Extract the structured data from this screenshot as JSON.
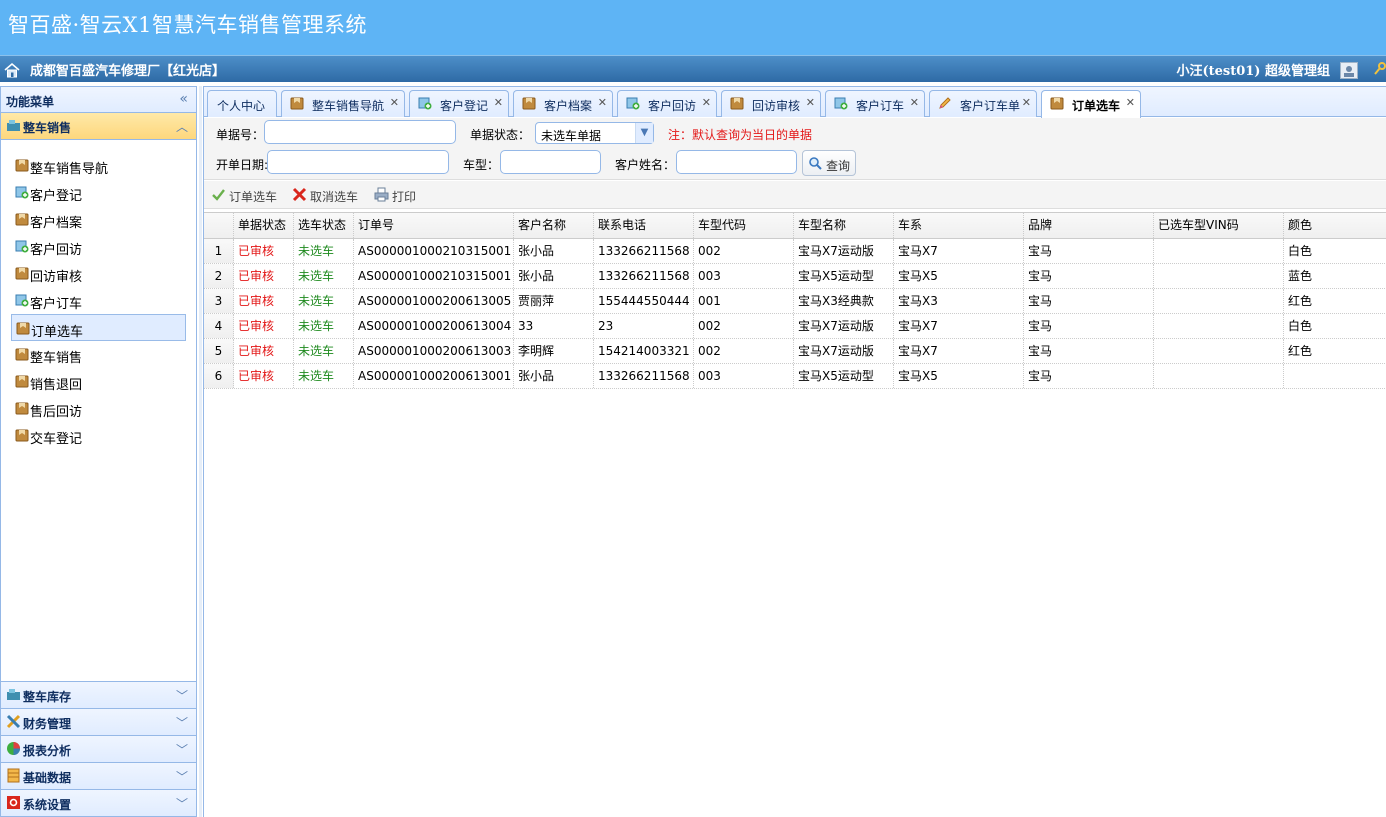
{
  "app": {
    "title": "智百盛·智云X1智慧汽车销售管理系统",
    "org": "成都智百盛汽车修理厂【红光店】",
    "user": "小汪(test01)  超级管理组"
  },
  "sidebar": {
    "title": "功能菜单",
    "active_group": "整车销售",
    "items": [
      {
        "label": "整车销售导航",
        "icon": "package-icon"
      },
      {
        "label": "客户登记",
        "icon": "add-record-icon"
      },
      {
        "label": "客户档案",
        "icon": "package-icon"
      },
      {
        "label": "客户回访",
        "icon": "add-record-icon"
      },
      {
        "label": "回访审核",
        "icon": "package-icon"
      },
      {
        "label": "客户订车",
        "icon": "add-record-icon"
      },
      {
        "label": "订单选车",
        "icon": "package-icon"
      },
      {
        "label": "整车销售",
        "icon": "package-icon"
      },
      {
        "label": "销售退回",
        "icon": "package-icon"
      },
      {
        "label": "售后回访",
        "icon": "package-icon"
      },
      {
        "label": "交车登记",
        "icon": "package-icon"
      }
    ],
    "selected_index": 6,
    "groups": [
      "整车库存",
      "财务管理",
      "报表分析",
      "基础数据",
      "系统设置"
    ]
  },
  "tabs": [
    {
      "label": "个人中心",
      "closable": false,
      "icon": ""
    },
    {
      "label": "整车销售导航",
      "closable": true,
      "icon": "package-icon"
    },
    {
      "label": "客户登记",
      "closable": true,
      "icon": "add-record-icon"
    },
    {
      "label": "客户档案",
      "closable": true,
      "icon": "package-icon"
    },
    {
      "label": "客户回访",
      "closable": true,
      "icon": "add-record-icon"
    },
    {
      "label": "回访审核",
      "closable": true,
      "icon": "package-icon"
    },
    {
      "label": "客户订车",
      "closable": true,
      "icon": "add-record-icon"
    },
    {
      "label": "客户订车单",
      "closable": true,
      "icon": "pencil-icon"
    },
    {
      "label": "订单选车",
      "closable": true,
      "icon": "package-icon",
      "active": true
    }
  ],
  "search": {
    "order_no_label": "单据号：",
    "order_no_value": "",
    "status_label": "单据状态：",
    "status_value": "未选车单据",
    "note": "注：默认查询为当日的单据",
    "date_label": "开单日期:",
    "date_value": "",
    "model_label": "车型：",
    "model_value": "",
    "customer_label": "客户姓名：",
    "customer_value": "",
    "search_button": "查询"
  },
  "toolbar": {
    "select_car": "订单选车",
    "cancel_select": "取消选车",
    "print": "打印"
  },
  "grid": {
    "columns": [
      "单据状态",
      "选车状态",
      "订单号",
      "客户名称",
      "联系电话",
      "车型代码",
      "车型名称",
      "车系",
      "品牌",
      "已选车型VIN码",
      "颜色"
    ],
    "rows": [
      [
        "1",
        "已审核",
        "未选车",
        "AS000001000210315001",
        "张小品",
        "133266211568",
        "002",
        "宝马X7运动版",
        "宝马X7",
        "宝马",
        "",
        "白色"
      ],
      [
        "2",
        "已审核",
        "未选车",
        "AS000001000210315001",
        "张小品",
        "133266211568",
        "003",
        "宝马X5运动型",
        "宝马X5",
        "宝马",
        "",
        "蓝色"
      ],
      [
        "3",
        "已审核",
        "未选车",
        "AS000001000200613005",
        "贾丽萍",
        "155444550444",
        "001",
        "宝马X3经典款",
        "宝马X3",
        "宝马",
        "",
        "红色"
      ],
      [
        "4",
        "已审核",
        "未选车",
        "AS000001000200613004",
        "33",
        "23",
        "002",
        "宝马X7运动版",
        "宝马X7",
        "宝马",
        "",
        "白色"
      ],
      [
        "5",
        "已审核",
        "未选车",
        "AS000001000200613003",
        "李明辉",
        "154214003321",
        "002",
        "宝马X7运动版",
        "宝马X7",
        "宝马",
        "",
        "红色"
      ],
      [
        "6",
        "已审核",
        "未选车",
        "AS000001000200613001",
        "张小品",
        "133266211568",
        "003",
        "宝马X5运动型",
        "宝马X5",
        "宝马",
        "",
        ""
      ]
    ]
  },
  "colors": {
    "header_bg": "#5eb4f5",
    "status_red": "#e31818",
    "status_green": "#1f8a1f"
  }
}
